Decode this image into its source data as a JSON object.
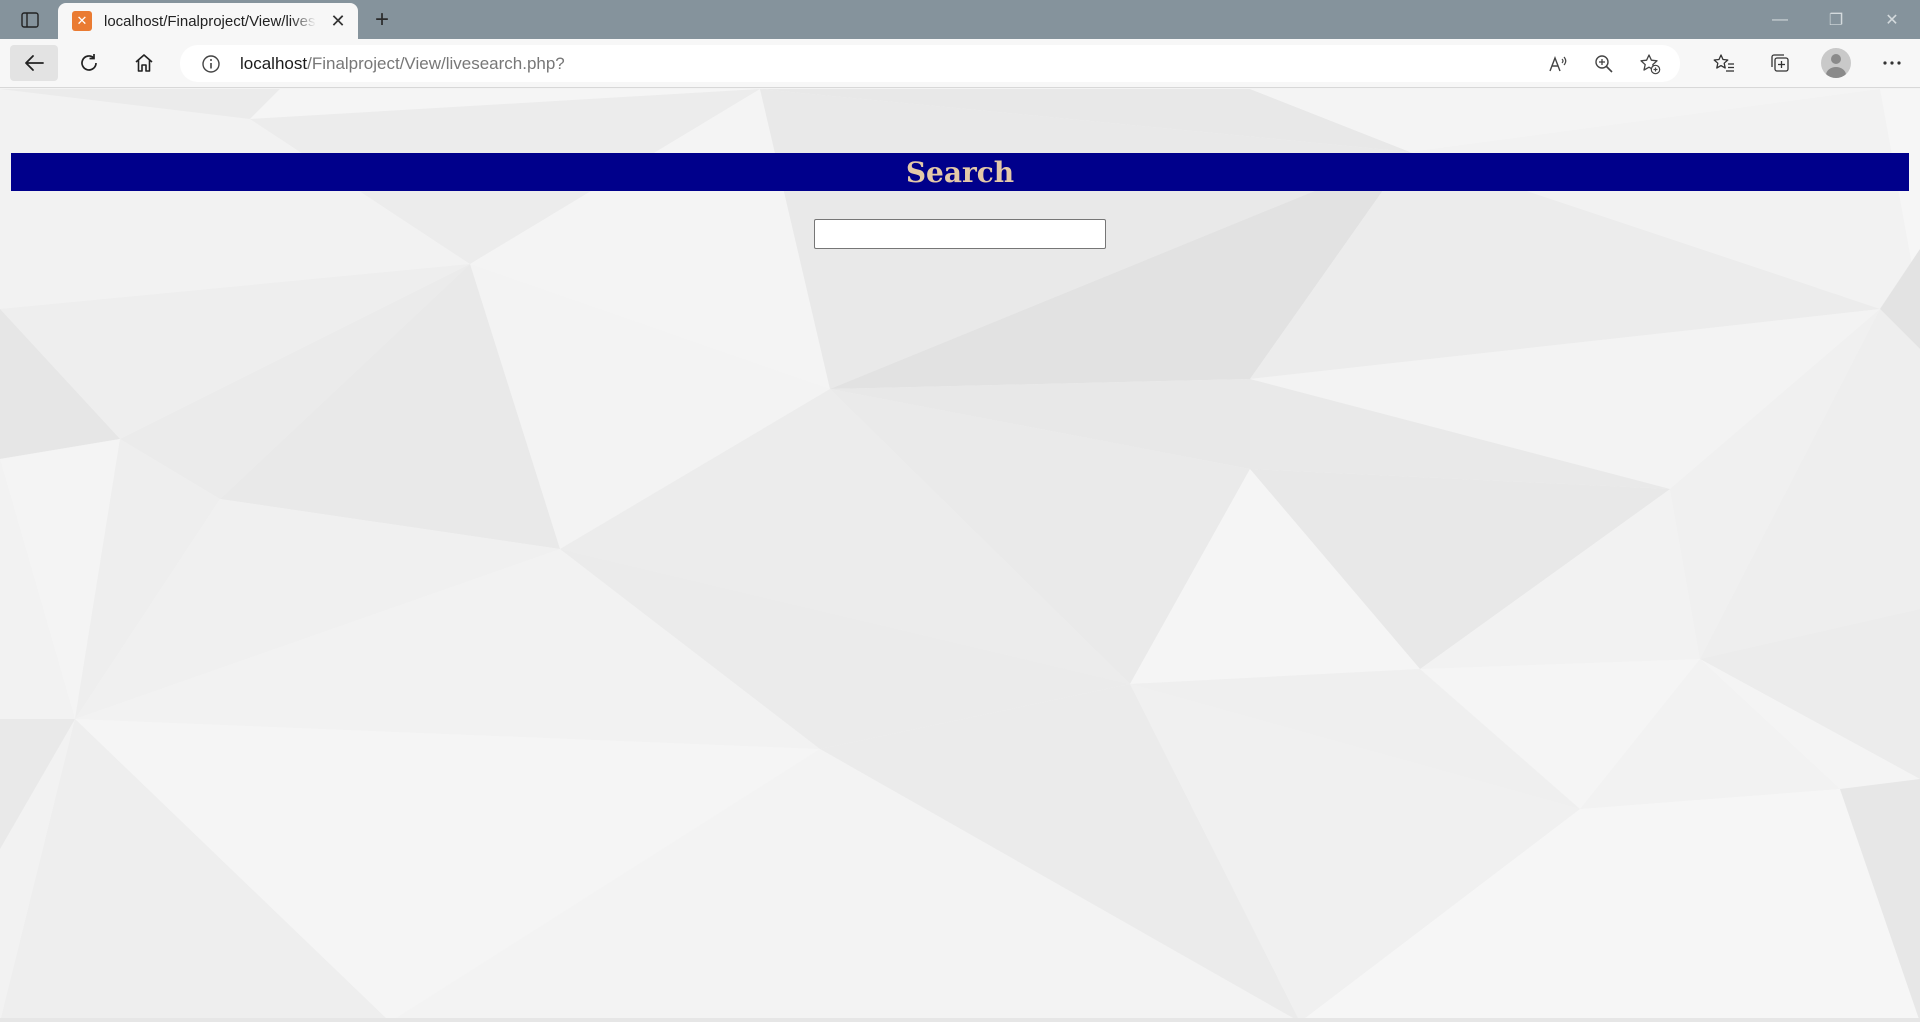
{
  "browser": {
    "tab": {
      "title": "localhost/Finalproject/View/livesearch.php?",
      "favicon": "xampp-icon"
    },
    "address": {
      "host": "localhost",
      "path": "/Finalproject/View/livesearch.php?"
    },
    "icons": {
      "tab_actions": "tab-actions-icon",
      "new_tab": "plus-icon",
      "back": "back-arrow-icon",
      "reload": "reload-icon",
      "home": "home-icon",
      "info": "info-icon",
      "read_aloud": "read-aloud-icon",
      "zoom": "zoom-in-icon",
      "add_favorite": "add-favorite-icon",
      "favorites": "favorites-icon",
      "collections": "collections-icon",
      "profile": "profile-icon",
      "menu": "more-icon"
    }
  },
  "page": {
    "heading": "Search",
    "search_value": "",
    "colors": {
      "banner": "#00008b",
      "heading_text": "#e3c9a8"
    }
  }
}
